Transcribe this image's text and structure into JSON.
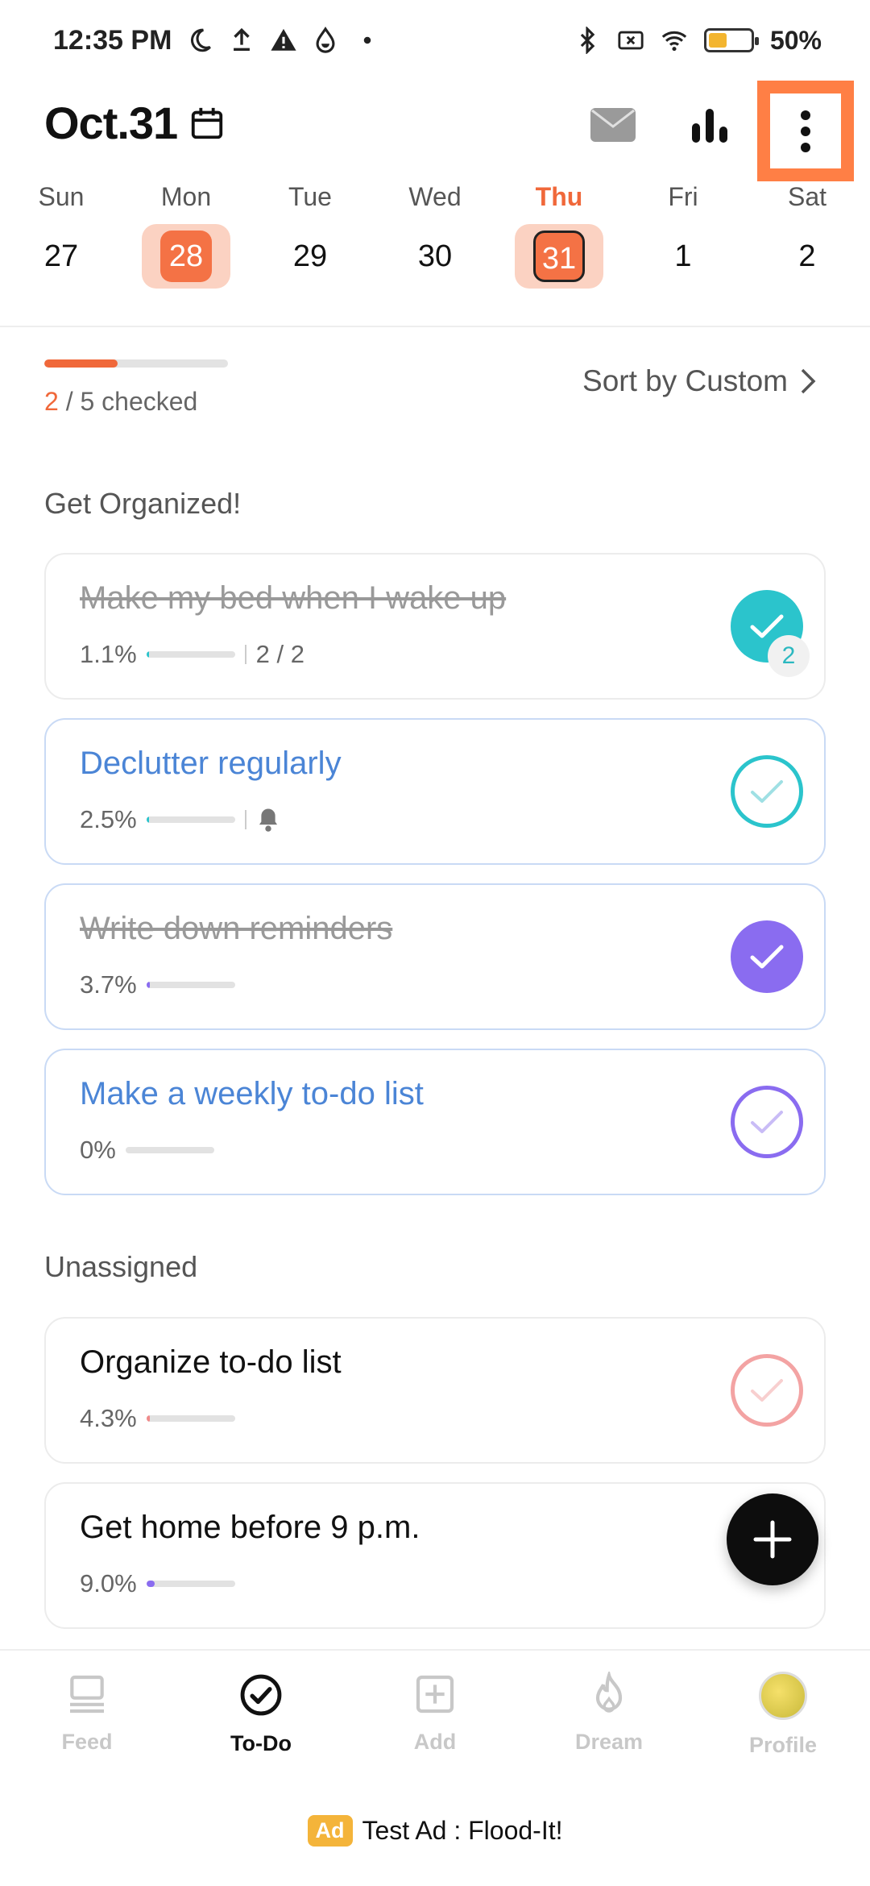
{
  "status_bar": {
    "time": "12:35 PM",
    "battery": "50%",
    "battery_level": 0.5
  },
  "header": {
    "date": "Oct.31",
    "icons": [
      "calendar-icon",
      "mail-icon",
      "stats-icon",
      "more-icon"
    ]
  },
  "week": [
    {
      "name": "Sun",
      "num": "27"
    },
    {
      "name": "Mon",
      "num": "28"
    },
    {
      "name": "Tue",
      "num": "29"
    },
    {
      "name": "Wed",
      "num": "30"
    },
    {
      "name": "Thu",
      "num": "31"
    },
    {
      "name": "Fri",
      "num": "1"
    },
    {
      "name": "Sat",
      "num": "2"
    }
  ],
  "progress": {
    "done": "2",
    "rest": " / 5 checked",
    "fraction": 0.4
  },
  "sort": {
    "label": "Sort by Custom"
  },
  "sections": {
    "organized": "Get Organized!",
    "unassigned": "Unassigned"
  },
  "tasks": [
    {
      "title": "Make my bed when I wake up",
      "percent": "1.1%",
      "count": "2 / 2",
      "badge": "2",
      "fill": 0.011,
      "color": "#2bc4cc"
    },
    {
      "title": "Declutter regularly",
      "percent": "2.5%",
      "fill": 0.025,
      "color": "#2bc4cc"
    },
    {
      "title": "Write down reminders",
      "percent": "3.7%",
      "fill": 0.037,
      "color": "#8a6cf0"
    },
    {
      "title": "Make a weekly to-do list",
      "percent": "0%",
      "fill": 0.0,
      "color": "#8a6cf0"
    },
    {
      "title": "Organize to-do list",
      "percent": "4.3%",
      "fill": 0.043,
      "color": "#f08a8a"
    },
    {
      "title": "Get home before 9 p.m.",
      "percent": "9.0%",
      "fill": 0.09,
      "color": "#8a6cf0"
    }
  ],
  "nav": {
    "feed": "Feed",
    "todo": "To-Do",
    "add": "Add",
    "dream": "Dream",
    "profile": "Profile"
  },
  "ad": {
    "badge": "Ad",
    "text": "Test Ad : Flood-It!"
  },
  "colors": {
    "accent": "#f0683a",
    "teal": "#2bc4cc",
    "purple": "#8a6cf0",
    "blue": "#4b85d6",
    "pink": "#f08a8a"
  }
}
